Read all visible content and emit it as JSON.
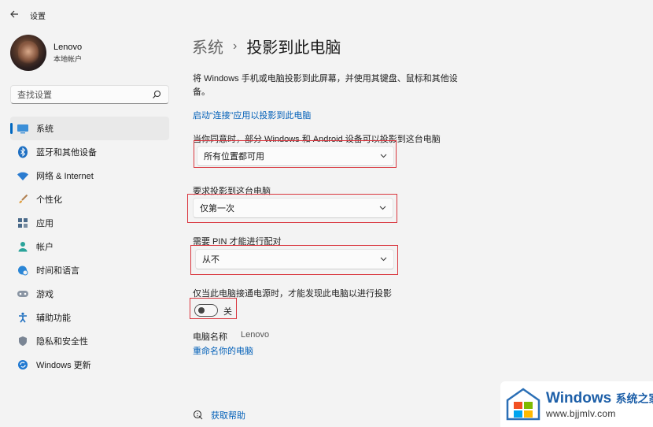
{
  "window": {
    "title": "设置"
  },
  "profile": {
    "name": "Lenovo",
    "account_type": "本地帐户"
  },
  "search": {
    "placeholder": "查找设置"
  },
  "sidebar": {
    "items": [
      {
        "label": "系统",
        "icon": "monitor-icon",
        "active": true
      },
      {
        "label": "蓝牙和其他设备",
        "icon": "bluetooth-icon",
        "active": false
      },
      {
        "label": "网络 & Internet",
        "icon": "wifi-icon",
        "active": false
      },
      {
        "label": "个性化",
        "icon": "brush-icon",
        "active": false
      },
      {
        "label": "应用",
        "icon": "apps-icon",
        "active": false
      },
      {
        "label": "帐户",
        "icon": "person-icon",
        "active": false
      },
      {
        "label": "时间和语言",
        "icon": "globe-clock-icon",
        "active": false
      },
      {
        "label": "游戏",
        "icon": "gamepad-icon",
        "active": false
      },
      {
        "label": "辅助功能",
        "icon": "accessibility-icon",
        "active": false
      },
      {
        "label": "隐私和安全性",
        "icon": "shield-icon",
        "active": false
      },
      {
        "label": "Windows 更新",
        "icon": "update-icon",
        "active": false
      }
    ]
  },
  "breadcrumb": {
    "parent": "系统",
    "separator": "›",
    "current": "投影到此电脑"
  },
  "main": {
    "description": "将 Windows 手机或电脑投影到此屏幕，并使用其键盘、鼠标和其他设备。",
    "launch_link": "启动“连接”应用以投影到此电脑",
    "availability": {
      "label": "当你同意时，部分 Windows 和 Android 设备可以投影到这台电脑",
      "value": "所有位置都可用"
    },
    "ask_to_project": {
      "label": "要求投影到这台电脑",
      "value": "仅第一次"
    },
    "require_pin": {
      "label": "需要 PIN 才能进行配对",
      "value": "从不"
    },
    "power_only": {
      "label": "仅当此电脑接通电源时，才能发现此电脑以进行投影",
      "state": "关",
      "on": false
    },
    "pc_name": {
      "label": "电脑名称",
      "value": "Lenovo"
    },
    "rename_link": "重命名你的电脑",
    "help_link": "获取帮助"
  },
  "watermark": {
    "title": "Windows",
    "title_cn": "系统之家",
    "url": "www.bjjmlv.com"
  },
  "colors": {
    "accent": "#0067c0",
    "link": "#005fb8",
    "highlight_box": "#d9363e",
    "background": "#f3f3f3"
  }
}
